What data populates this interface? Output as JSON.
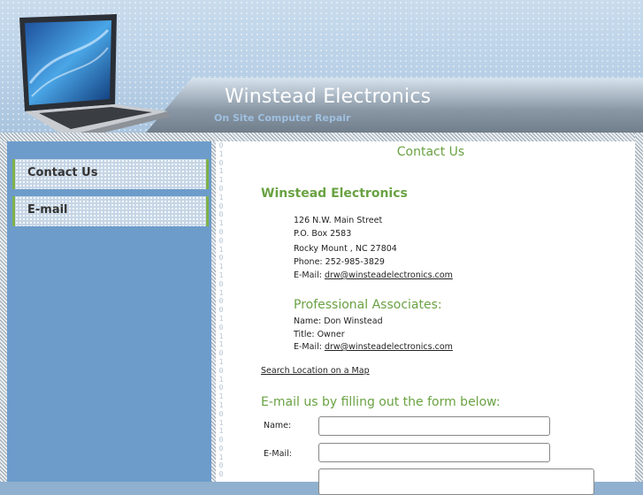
{
  "header": {
    "brand": "Winstead Electronics",
    "tagline": "On Site Computer Repair"
  },
  "nav": {
    "items": [
      {
        "label": "Contact Us"
      },
      {
        "label": "E-mail"
      }
    ]
  },
  "binary_digits": "0\n1\n0\n1\n1\n0\n1\n0\n0\n1\n0\n0\n1\n0\n1\n1\n0\n1\n0\n0\n1\n0\n1\n1\n0\n1\n0\n1\n0\n1\n1\n0\n1\n1\n0\n0\n1\n0\n0",
  "content": {
    "title": "Contact Us",
    "company": "Winstead Electronics",
    "address": {
      "street": "126 N.W. Main Street",
      "pobox": "P.O. Box 2583",
      "city": "Rocky Mount , NC 27804",
      "phone": "Phone: 252-985-3829",
      "email_label": "E-Mail: ",
      "email": "drw@winsteadelectronics.com "
    },
    "associates": {
      "title": "Professional Associates:",
      "name": "Name: Don Winstead",
      "role": "Title: Owner",
      "email_label": "E-Mail: ",
      "email": "drw@winsteadelectronics.com "
    },
    "map_link": "Search Location on a Map ",
    "form": {
      "title": "E-mail us by filling out the form below:",
      "name_label": "Name:",
      "email_label": "E-Mail:",
      "name_value": "",
      "email_value": ""
    }
  },
  "colors": {
    "accent_green": "#6aa243",
    "sidebar_blue": "#6d9ccb",
    "brand_text": "#ffffff"
  }
}
